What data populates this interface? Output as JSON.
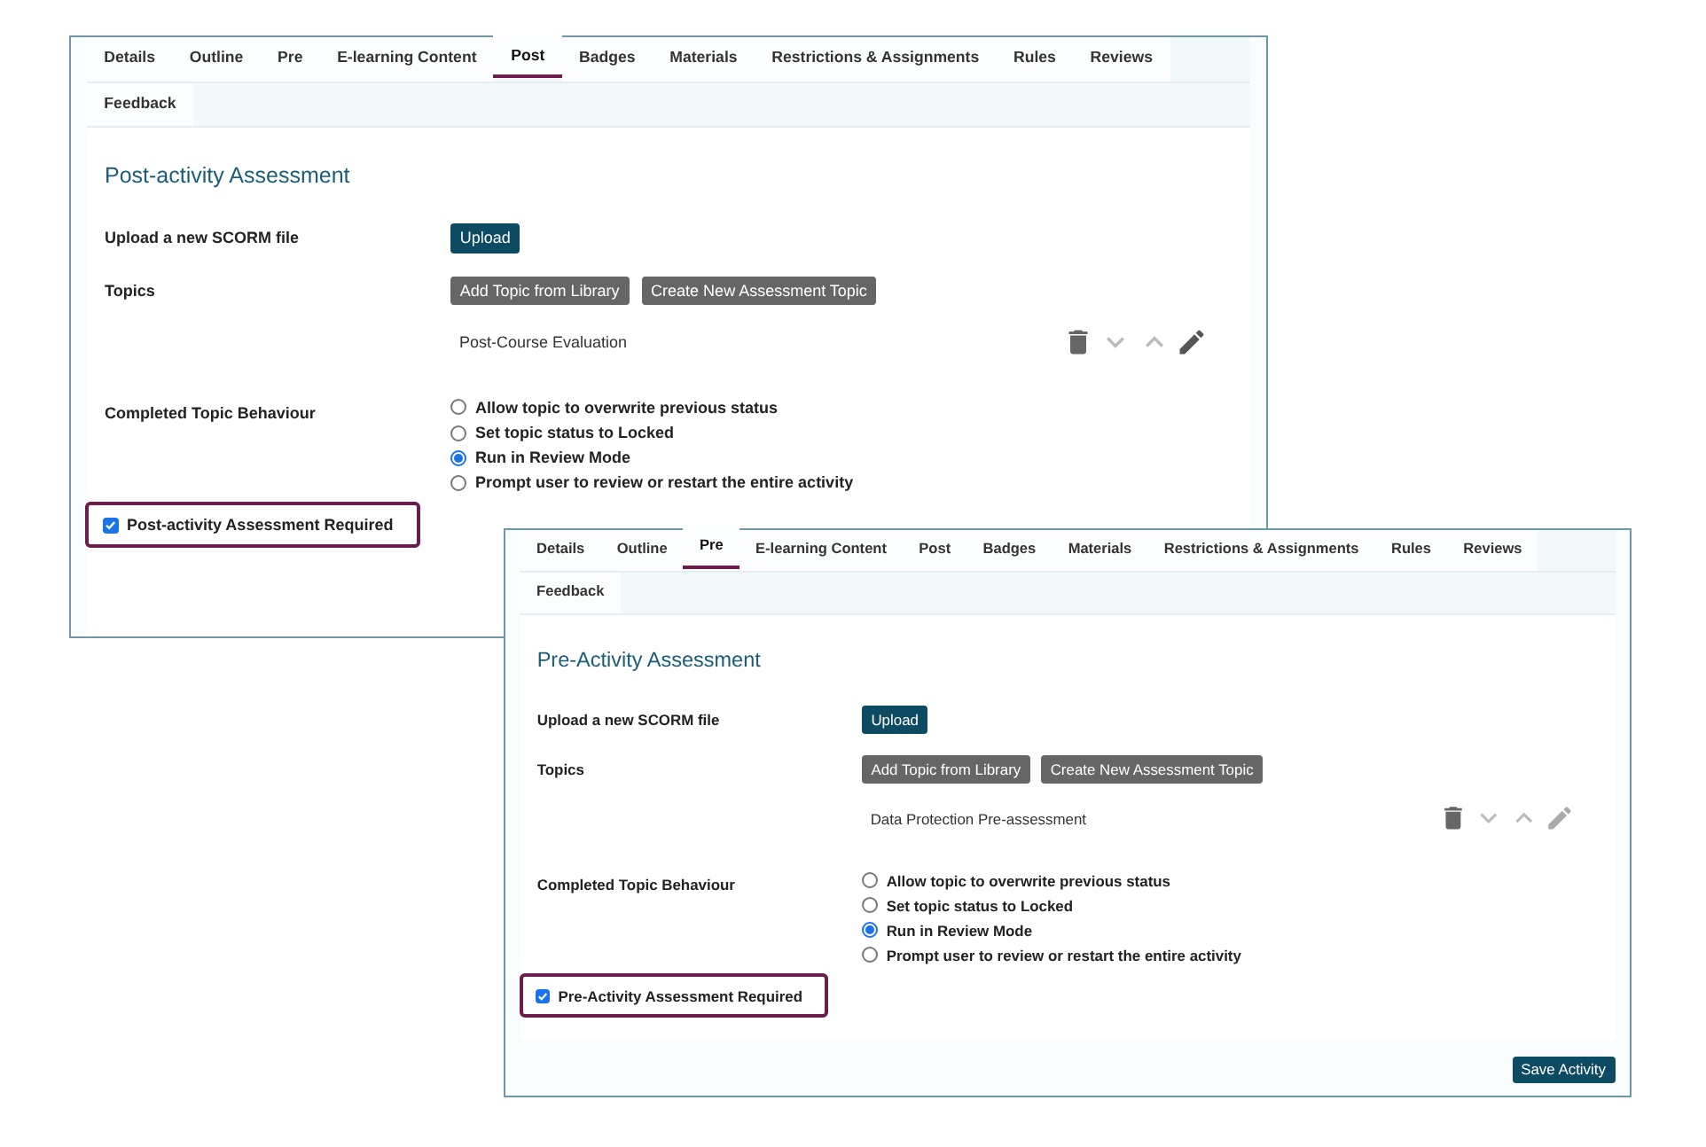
{
  "windows": [
    {
      "tab_rows": [
        [
          {
            "label": "Details",
            "selected": false
          },
          {
            "label": "Outline",
            "selected": false
          },
          {
            "label": "Pre",
            "selected": false
          },
          {
            "label": "E-learning Content",
            "selected": false
          },
          {
            "label": "Post",
            "selected": true
          },
          {
            "label": "Badges",
            "selected": false
          },
          {
            "label": "Materials",
            "selected": false
          },
          {
            "label": "Restrictions & Assignments",
            "selected": false
          },
          {
            "label": "Rules",
            "selected": false
          },
          {
            "label": "Reviews",
            "selected": false
          }
        ],
        [
          {
            "label": "Feedback",
            "selected": false
          }
        ]
      ],
      "title": "Post-activity Assessment",
      "upload": {
        "label": "Upload a new SCORM file",
        "button": "Upload"
      },
      "topics": {
        "label": "Topics",
        "buttons": [
          "Add Topic from Library",
          "Create New Assessment Topic"
        ],
        "items": [
          "Post-Course Evaluation"
        ]
      },
      "behaviour": {
        "label": "Completed Topic Behaviour",
        "options": [
          {
            "label": "Allow topic to overwrite previous status",
            "selected": false
          },
          {
            "label": "Set topic status to Locked",
            "selected": false
          },
          {
            "label": "Run in Review Mode",
            "selected": true
          },
          {
            "label": "Prompt user to review or restart the entire activity",
            "selected": false
          }
        ]
      },
      "required": {
        "label": "Post-activity Assessment Required",
        "checked": true
      }
    },
    {
      "tab_rows": [
        [
          {
            "label": "Details",
            "selected": false
          },
          {
            "label": "Outline",
            "selected": false
          },
          {
            "label": "Pre",
            "selected": true
          },
          {
            "label": "E-learning Content",
            "selected": false
          },
          {
            "label": "Post",
            "selected": false
          },
          {
            "label": "Badges",
            "selected": false
          },
          {
            "label": "Materials",
            "selected": false
          },
          {
            "label": "Restrictions & Assignments",
            "selected": false
          },
          {
            "label": "Rules",
            "selected": false
          },
          {
            "label": "Reviews",
            "selected": false
          }
        ],
        [
          {
            "label": "Feedback",
            "selected": false
          }
        ]
      ],
      "title": "Pre-Activity Assessment",
      "upload": {
        "label": "Upload a new SCORM file",
        "button": "Upload"
      },
      "topics": {
        "label": "Topics",
        "buttons": [
          "Add Topic from Library",
          "Create New Assessment Topic"
        ],
        "items": [
          "Data Protection Pre-assessment"
        ]
      },
      "behaviour": {
        "label": "Completed Topic Behaviour",
        "options": [
          {
            "label": "Allow topic to overwrite previous status",
            "selected": false
          },
          {
            "label": "Set topic status to Locked",
            "selected": false
          },
          {
            "label": "Run in Review Mode",
            "selected": true
          },
          {
            "label": "Prompt user to review or restart the entire activity",
            "selected": false
          }
        ]
      },
      "required": {
        "label": "Pre-Activity Assessment Required",
        "checked": true
      },
      "save_button": "Save Activity"
    }
  ]
}
